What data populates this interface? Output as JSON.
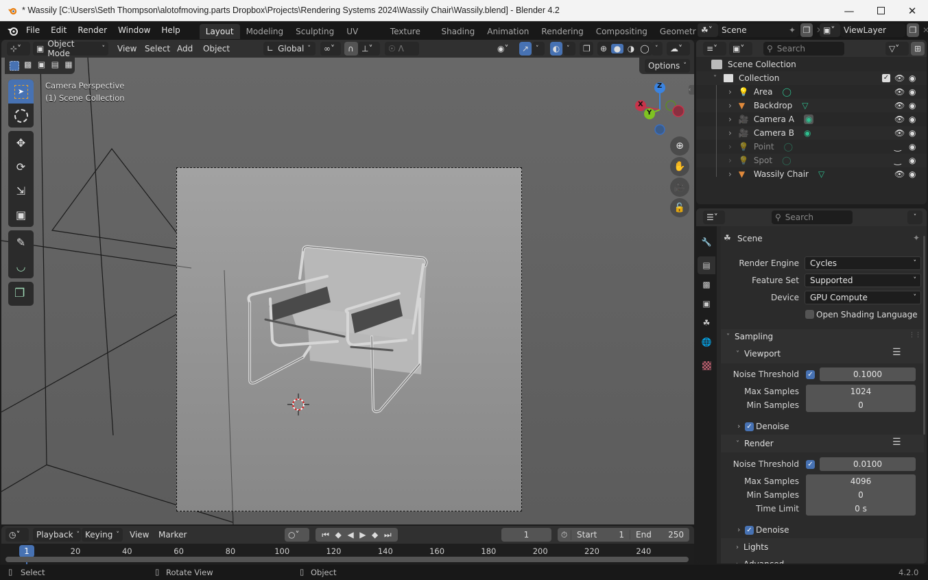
{
  "window": {
    "title": "* Wassily [C:\\Users\\Seth Thompson\\alotofmoving.parts Dropbox\\Projects\\Rendering Systems 2024\\Wassily Chair\\Wassily.blend] - Blender 4.2",
    "minimize_icon": "minimize-icon",
    "maximize_icon": "maximize-icon",
    "close_icon": "close-icon"
  },
  "menu": [
    "File",
    "Edit",
    "Render",
    "Window",
    "Help"
  ],
  "workspaces": [
    "Layout",
    "Modeling",
    "Sculpting",
    "UV Editing",
    "Texture Paint",
    "Shading",
    "Animation",
    "Rendering",
    "Compositing",
    "Geometry No"
  ],
  "active_workspace": "Layout",
  "scene_selector": {
    "scene": "Scene",
    "view_layer": "ViewLayer"
  },
  "viewport_header": {
    "mode": "Object Mode",
    "menus": [
      "View",
      "Select",
      "Add",
      "Object"
    ],
    "transform_orientation": "Global",
    "options_label": "Options"
  },
  "viewport": {
    "overlay_line1": "Camera Perspective",
    "overlay_line2": "(1) Scene Collection",
    "gizmo_axes": {
      "x": "X",
      "y": "Y",
      "z": "Z"
    },
    "colors": {
      "x": "#c8334a",
      "y": "#7fc321",
      "z": "#3a83e0"
    }
  },
  "outliner": {
    "search_placeholder": "Search",
    "root": "Scene Collection",
    "collection": "Collection",
    "items": [
      {
        "name": "Area",
        "type": "light",
        "visible": true,
        "dimmed": false
      },
      {
        "name": "Backdrop",
        "type": "mesh",
        "visible": true,
        "dimmed": false
      },
      {
        "name": "Camera A",
        "type": "camera",
        "visible": true,
        "dimmed": false,
        "active_data": true
      },
      {
        "name": "Camera B",
        "type": "camera",
        "visible": true,
        "dimmed": false
      },
      {
        "name": "Point",
        "type": "light",
        "visible": false,
        "dimmed": true
      },
      {
        "name": "Spot",
        "type": "light",
        "visible": false,
        "dimmed": true
      },
      {
        "name": "Wassily Chair",
        "type": "mesh",
        "visible": true,
        "dimmed": false
      }
    ]
  },
  "properties": {
    "search_placeholder": "Search",
    "context": "Scene",
    "render_engine_label": "Render Engine",
    "render_engine": "Cycles",
    "feature_set_label": "Feature Set",
    "feature_set": "Supported",
    "device_label": "Device",
    "device": "GPU Compute",
    "osl_label": "Open Shading Language",
    "osl_checked": false,
    "sampling": {
      "title": "Sampling",
      "viewport": {
        "title": "Viewport",
        "noise_threshold_label": "Noise Threshold",
        "noise_threshold_enabled": true,
        "noise_threshold": "0.1000",
        "max_samples_label": "Max Samples",
        "max_samples": "1024",
        "min_samples_label": "Min Samples",
        "min_samples": "0",
        "denoise_label": "Denoise",
        "denoise": true
      },
      "render": {
        "title": "Render",
        "noise_threshold_label": "Noise Threshold",
        "noise_threshold_enabled": true,
        "noise_threshold": "0.0100",
        "max_samples_label": "Max Samples",
        "max_samples": "4096",
        "min_samples_label": "Min Samples",
        "min_samples": "0",
        "time_limit_label": "Time Limit",
        "time_limit": "0 s",
        "denoise_label": "Denoise",
        "denoise": true
      },
      "lights_label": "Lights",
      "advanced_label": "Advanced"
    }
  },
  "timeline": {
    "menus": [
      "Playback",
      "Keying",
      "View",
      "Marker"
    ],
    "current_frame": "1",
    "start_label": "Start",
    "start": "1",
    "end_label": "End",
    "end": "250",
    "ticks": [
      "20",
      "40",
      "60",
      "80",
      "100",
      "120",
      "140",
      "160",
      "180",
      "200",
      "220",
      "240"
    ],
    "playhead": "1"
  },
  "status_bar": {
    "select": "Select",
    "rotate_view": "Rotate View",
    "object": "Object",
    "version": "4.2.0"
  }
}
